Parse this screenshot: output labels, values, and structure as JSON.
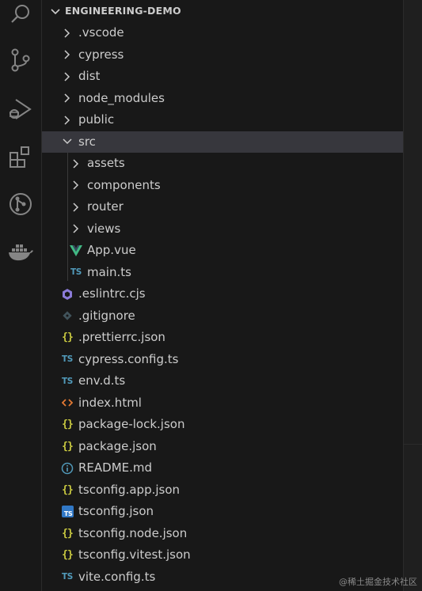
{
  "explorer": {
    "section_title": "ENGINEERING-DEMO",
    "items": [
      {
        "label": ".vscode",
        "type": "folder",
        "state": "collapsed",
        "depth": 0
      },
      {
        "label": "cypress",
        "type": "folder",
        "state": "collapsed",
        "depth": 0
      },
      {
        "label": "dist",
        "type": "folder",
        "state": "collapsed",
        "depth": 0
      },
      {
        "label": "node_modules",
        "type": "folder",
        "state": "collapsed",
        "depth": 0
      },
      {
        "label": "public",
        "type": "folder",
        "state": "collapsed",
        "depth": 0
      },
      {
        "label": "src",
        "type": "folder",
        "state": "expanded",
        "depth": 0,
        "selected": true
      },
      {
        "label": "assets",
        "type": "folder",
        "state": "collapsed",
        "depth": 1
      },
      {
        "label": "components",
        "type": "folder",
        "state": "collapsed",
        "depth": 1
      },
      {
        "label": "router",
        "type": "folder",
        "state": "collapsed",
        "depth": 1
      },
      {
        "label": "views",
        "type": "folder",
        "state": "collapsed",
        "depth": 1
      },
      {
        "label": "App.vue",
        "type": "file",
        "icon": "vue-icon",
        "depth": 1
      },
      {
        "label": "main.ts",
        "type": "file",
        "icon": "ts-icon",
        "icon_text": "TS",
        "depth": 1
      },
      {
        "label": ".eslintrc.cjs",
        "type": "file",
        "icon": "eslint-icon",
        "depth": 0
      },
      {
        "label": ".gitignore",
        "type": "file",
        "icon": "git-icon",
        "depth": 0
      },
      {
        "label": ".prettierrc.json",
        "type": "file",
        "icon": "json-icon",
        "icon_text": "{}",
        "depth": 0
      },
      {
        "label": "cypress.config.ts",
        "type": "file",
        "icon": "ts-icon",
        "icon_text": "TS",
        "depth": 0
      },
      {
        "label": "env.d.ts",
        "type": "file",
        "icon": "ts-icon",
        "icon_text": "TS",
        "depth": 0
      },
      {
        "label": "index.html",
        "type": "file",
        "icon": "html-icon",
        "depth": 0
      },
      {
        "label": "package-lock.json",
        "type": "file",
        "icon": "json-icon",
        "icon_text": "{}",
        "depth": 0
      },
      {
        "label": "package.json",
        "type": "file",
        "icon": "json-icon",
        "icon_text": "{}",
        "depth": 0
      },
      {
        "label": "README.md",
        "type": "file",
        "icon": "info-icon",
        "depth": 0
      },
      {
        "label": "tsconfig.app.json",
        "type": "file",
        "icon": "json-icon",
        "icon_text": "{}",
        "depth": 0
      },
      {
        "label": "tsconfig.json",
        "type": "file",
        "icon": "tsconfig-icon",
        "icon_text": "TS",
        "depth": 0
      },
      {
        "label": "tsconfig.node.json",
        "type": "file",
        "icon": "json-icon",
        "icon_text": "{}",
        "depth": 0
      },
      {
        "label": "tsconfig.vitest.json",
        "type": "file",
        "icon": "json-icon",
        "icon_text": "{}",
        "depth": 0
      },
      {
        "label": "vite.config.ts",
        "type": "file",
        "icon": "ts-icon",
        "icon_text": "TS",
        "depth": 0
      }
    ]
  },
  "activity_bar": {
    "icons": [
      "search-icon",
      "source-control-icon",
      "run-debug-icon",
      "extensions-icon",
      "git-graph-icon",
      "docker-icon"
    ]
  },
  "watermark": "@稀土掘金技术社区",
  "colors": {
    "background": "#181818",
    "selected_row": "#37373d",
    "text": "#cccccc",
    "ts_blue": "#519aba",
    "json_yellow": "#cbcb41",
    "vue_green": "#41b883",
    "eslint_purple": "#8b7bd8",
    "html_orange": "#e37933"
  }
}
